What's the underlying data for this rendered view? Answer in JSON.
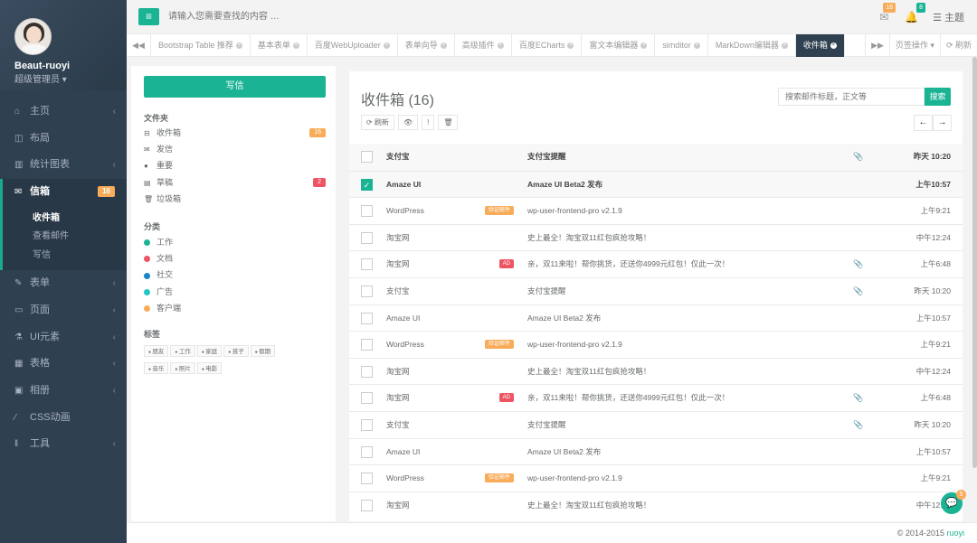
{
  "colors": {
    "primary": "#1ab394",
    "sidebar": "#2f4050",
    "warning": "#f8ac59",
    "danger": "#ed5565",
    "info": "#23c6c8",
    "blue": "#1c84c6",
    "navy": "#2f4050"
  },
  "user": {
    "name": "Beaut-ruoyi",
    "role": "超级管理员 ▾"
  },
  "sidebar": {
    "items": [
      {
        "label": "主页",
        "icon": "home-icon",
        "glyph": "⌂",
        "arrow": "‹"
      },
      {
        "label": "布局",
        "icon": "layout-icon",
        "glyph": "◫",
        "arrow": ""
      },
      {
        "label": "统计图表",
        "icon": "bar-chart-icon",
        "glyph": "▥",
        "arrow": "‹"
      },
      {
        "label": "信箱",
        "icon": "envelope-icon",
        "glyph": "✉",
        "badge": "16"
      },
      {
        "label": "表单",
        "icon": "edit-icon",
        "glyph": "✎",
        "arrow": "‹"
      },
      {
        "label": "页面",
        "icon": "desktop-icon",
        "glyph": "▭",
        "arrow": "‹"
      },
      {
        "label": "UI元素",
        "icon": "flask-icon",
        "glyph": "⚗",
        "arrow": "‹"
      },
      {
        "label": "表格",
        "icon": "table-icon",
        "glyph": "▦",
        "arrow": "‹"
      },
      {
        "label": "相册",
        "icon": "picture-icon",
        "glyph": "▣",
        "arrow": "‹"
      },
      {
        "label": "CSS动画",
        "icon": "magic-icon",
        "glyph": "⁄",
        "arrow": ""
      },
      {
        "label": "工具",
        "icon": "cutlery-icon",
        "glyph": "‖",
        "arrow": "‹"
      }
    ],
    "mail_sub": [
      "收件箱",
      "查看邮件",
      "写信"
    ]
  },
  "top": {
    "search_placeholder": "请输入您需要查找的内容 …",
    "mail_badge": "16",
    "bell_badge": "8",
    "theme": "☰ 主题"
  },
  "tabs": [
    "Bootstrap Table 推荐",
    "基本表单",
    "百度WebUploader",
    "表单向导",
    "高级插件",
    "百度ECharts",
    "富文本编辑器",
    "simditor",
    "MarkDown编辑器",
    "收件箱"
  ],
  "tab_actions": {
    "left": "◀◀",
    "right": "▶▶",
    "ops": "页签操作 ▾",
    "refresh": "⟳ 刷新"
  },
  "mailnav": {
    "compose": "写信",
    "folders_title": "文件夹",
    "folders": [
      {
        "label": "收件箱",
        "glyph": "⊟",
        "badge": "16",
        "badge_color": "#f8ac59"
      },
      {
        "label": "发信",
        "glyph": "✉",
        "badge": ""
      },
      {
        "label": "重要",
        "glyph": "●",
        "badge": ""
      },
      {
        "label": "草稿",
        "glyph": "▤",
        "badge": "2",
        "badge_color": "#ed5565"
      },
      {
        "label": "垃圾箱",
        "glyph": "🗑",
        "badge": ""
      }
    ],
    "categories_title": "分类",
    "categories": [
      {
        "label": "工作",
        "color": "#1ab394"
      },
      {
        "label": "文档",
        "color": "#ed5565"
      },
      {
        "label": "社交",
        "color": "#1c84c6"
      },
      {
        "label": "广告",
        "color": "#23c6c8"
      },
      {
        "label": "客户端",
        "color": "#f8ac59"
      }
    ],
    "tags_title": "标签",
    "tags": [
      "朋友",
      "工作",
      "家庭",
      "孩子",
      "假期",
      "音乐",
      "照片",
      "电影"
    ]
  },
  "mailbox": {
    "title": "收件箱 (16)",
    "search_placeholder": "搜索邮件标题，正文等",
    "search_btn": "搜索",
    "tools": [
      "⟳ 刷新",
      "👁",
      "!",
      "🗑"
    ],
    "rows": [
      {
        "sender": "支付宝",
        "label": "",
        "label_color": "",
        "subject": "支付宝提醒",
        "clip": "📎",
        "time": "昨天 10:20",
        "unread": true,
        "checked": false
      },
      {
        "sender": "Amaze UI",
        "label": "",
        "label_color": "",
        "subject": "Amaze UI Beta2 发布",
        "clip": "",
        "time": "上午10:57",
        "unread": true,
        "checked": true
      },
      {
        "sender": "WordPress",
        "label": "验证邮件",
        "label_color": "#f8ac59",
        "subject": "wp-user-frontend-pro v2.1.9",
        "clip": "",
        "time": "上午9:21",
        "unread": false,
        "checked": false
      },
      {
        "sender": "淘宝网",
        "label": "",
        "label_color": "",
        "subject": "史上最全！淘宝双11红包疯抢攻略！",
        "clip": "",
        "time": "中午12:24",
        "unread": false,
        "checked": false
      },
      {
        "sender": "淘宝网",
        "label": "AD",
        "label_color": "#ed5565",
        "subject": "亲，双11来啦！帮你挑货，还送你4999元红包！仅此一次！",
        "clip": "📎",
        "time": "上午6:48",
        "unread": false,
        "checked": false
      },
      {
        "sender": "支付宝",
        "label": "",
        "label_color": "",
        "subject": "支付宝提醒",
        "clip": "📎",
        "time": "昨天 10:20",
        "unread": false,
        "checked": false
      },
      {
        "sender": "Amaze UI",
        "label": "",
        "label_color": "",
        "subject": "Amaze UI Beta2 发布",
        "clip": "",
        "time": "上午10:57",
        "unread": false,
        "checked": false
      },
      {
        "sender": "WordPress",
        "label": "验证邮件",
        "label_color": "#f8ac59",
        "subject": "wp-user-frontend-pro v2.1.9",
        "clip": "",
        "time": "上午9:21",
        "unread": false,
        "checked": false
      },
      {
        "sender": "淘宝网",
        "label": "",
        "label_color": "",
        "subject": "史上最全！淘宝双11红包疯抢攻略！",
        "clip": "",
        "time": "中午12:24",
        "unread": false,
        "checked": false
      },
      {
        "sender": "淘宝网",
        "label": "AD",
        "label_color": "#ed5565",
        "subject": "亲，双11来啦！帮你挑货，还送你4999元红包！仅此一次！",
        "clip": "📎",
        "time": "上午6:48",
        "unread": false,
        "checked": false
      },
      {
        "sender": "支付宝",
        "label": "",
        "label_color": "",
        "subject": "支付宝提醒",
        "clip": "📎",
        "time": "昨天 10:20",
        "unread": false,
        "checked": false
      },
      {
        "sender": "Amaze UI",
        "label": "",
        "label_color": "",
        "subject": "Amaze UI Beta2 发布",
        "clip": "",
        "time": "上午10:57",
        "unread": false,
        "checked": false
      },
      {
        "sender": "WordPress",
        "label": "验证邮件",
        "label_color": "#f8ac59",
        "subject": "wp-user-frontend-pro v2.1.9",
        "clip": "",
        "time": "上午9:21",
        "unread": false,
        "checked": false
      },
      {
        "sender": "淘宝网",
        "label": "",
        "label_color": "",
        "subject": "史上最全！淘宝双11红包疯抢攻略！",
        "clip": "",
        "time": "中午12:24",
        "unread": false,
        "checked": false
      }
    ]
  },
  "footer": {
    "copyright": "© 2014-2015 ",
    "link": "ruoyi"
  },
  "chat": {
    "badge": "5"
  }
}
